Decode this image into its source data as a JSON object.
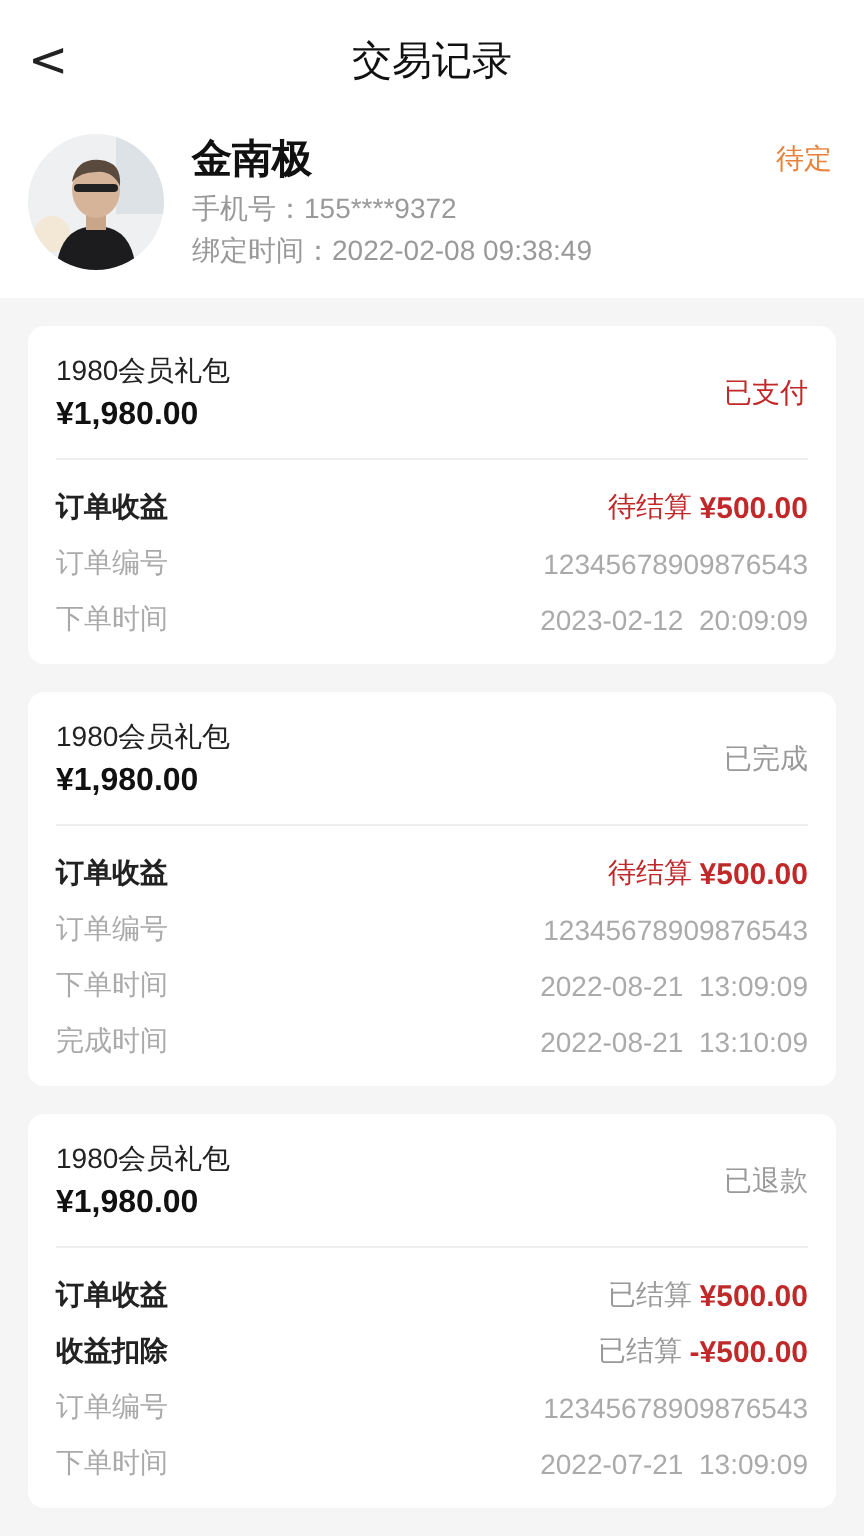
{
  "header": {
    "back": "<",
    "title": "交易记录"
  },
  "profile": {
    "name": "金南极",
    "status": "待定",
    "phone": "手机号：155****9372",
    "bound": "绑定时间：2022-02-08 09:38:49"
  },
  "orders": [
    {
      "product": "1980会员礼包",
      "price": "¥1,980.00",
      "status": "已支付",
      "color": "#c0282a",
      "rows": [
        {
          "kind": "income",
          "label": "订单收益",
          "state": "待结算",
          "settled": false,
          "amount": "¥500.00"
        },
        {
          "kind": "info",
          "label": "订单编号",
          "value": "12345678909876543"
        },
        {
          "kind": "info",
          "label": "下单时间",
          "value": "2023-02-12  20:09:09"
        }
      ]
    },
    {
      "product": "1980会员礼包",
      "price": "¥1,980.00",
      "status": "已完成",
      "color": "#999999",
      "rows": [
        {
          "kind": "income",
          "label": "订单收益",
          "state": "待结算",
          "settled": false,
          "amount": "¥500.00"
        },
        {
          "kind": "info",
          "label": "订单编号",
          "value": "12345678909876543"
        },
        {
          "kind": "info",
          "label": "下单时间",
          "value": "2022-08-21  13:09:09"
        },
        {
          "kind": "info",
          "label": "完成时间",
          "value": "2022-08-21  13:10:09"
        }
      ]
    },
    {
      "product": "1980会员礼包",
      "price": "¥1,980.00",
      "status": "已退款",
      "color": "#999999",
      "rows": [
        {
          "kind": "income",
          "label": "订单收益",
          "state": "已结算",
          "settled": true,
          "amount": "¥500.00"
        },
        {
          "kind": "income",
          "label": "收益扣除",
          "state": "已结算",
          "settled": true,
          "amount": "-¥500.00"
        },
        {
          "kind": "info",
          "label": "订单编号",
          "value": "12345678909876543"
        },
        {
          "kind": "info",
          "label": "下单时间",
          "value": "2022-07-21  13:09:09"
        }
      ]
    }
  ]
}
